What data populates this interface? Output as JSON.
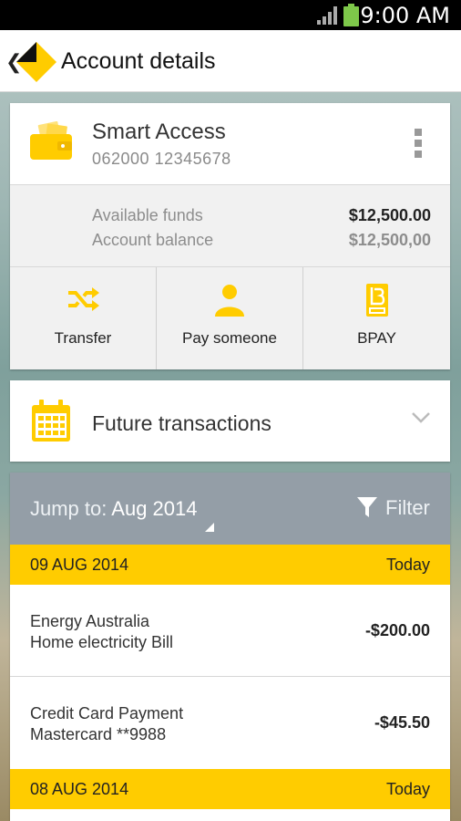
{
  "status_bar": {
    "time": "9:00 AM"
  },
  "app_bar": {
    "title": "Account details"
  },
  "account": {
    "name": "Smart Access",
    "number": "062000 12345678",
    "available_funds_label": "Available funds",
    "available_funds_value": "$12,500.00",
    "account_balance_label": "Account balance",
    "account_balance_value": "$12,500,00"
  },
  "actions": [
    {
      "label": "Transfer",
      "icon": "transfer-icon"
    },
    {
      "label": "Pay someone",
      "icon": "person-icon"
    },
    {
      "label": "BPAY",
      "icon": "bpay-icon"
    }
  ],
  "future": {
    "label": "Future transactions"
  },
  "transactions": {
    "jump_prefix": "Jump to: ",
    "jump_month": "Aug 2014",
    "filter_label": "Filter",
    "groups": [
      {
        "date": "09 AUG 2014",
        "tag": "Today",
        "items": [
          {
            "line1": "Energy Australia",
            "line2": "Home electricity Bill",
            "amount": "-$200.00"
          },
          {
            "line1": "Credit Card Payment",
            "line2": "Mastercard **9988",
            "amount": "-$45.50"
          }
        ]
      },
      {
        "date": "08 AUG 2014",
        "tag": "Today"
      }
    ]
  },
  "colors": {
    "accent": "#ffcc00",
    "jump_bar": "#949ea7"
  }
}
